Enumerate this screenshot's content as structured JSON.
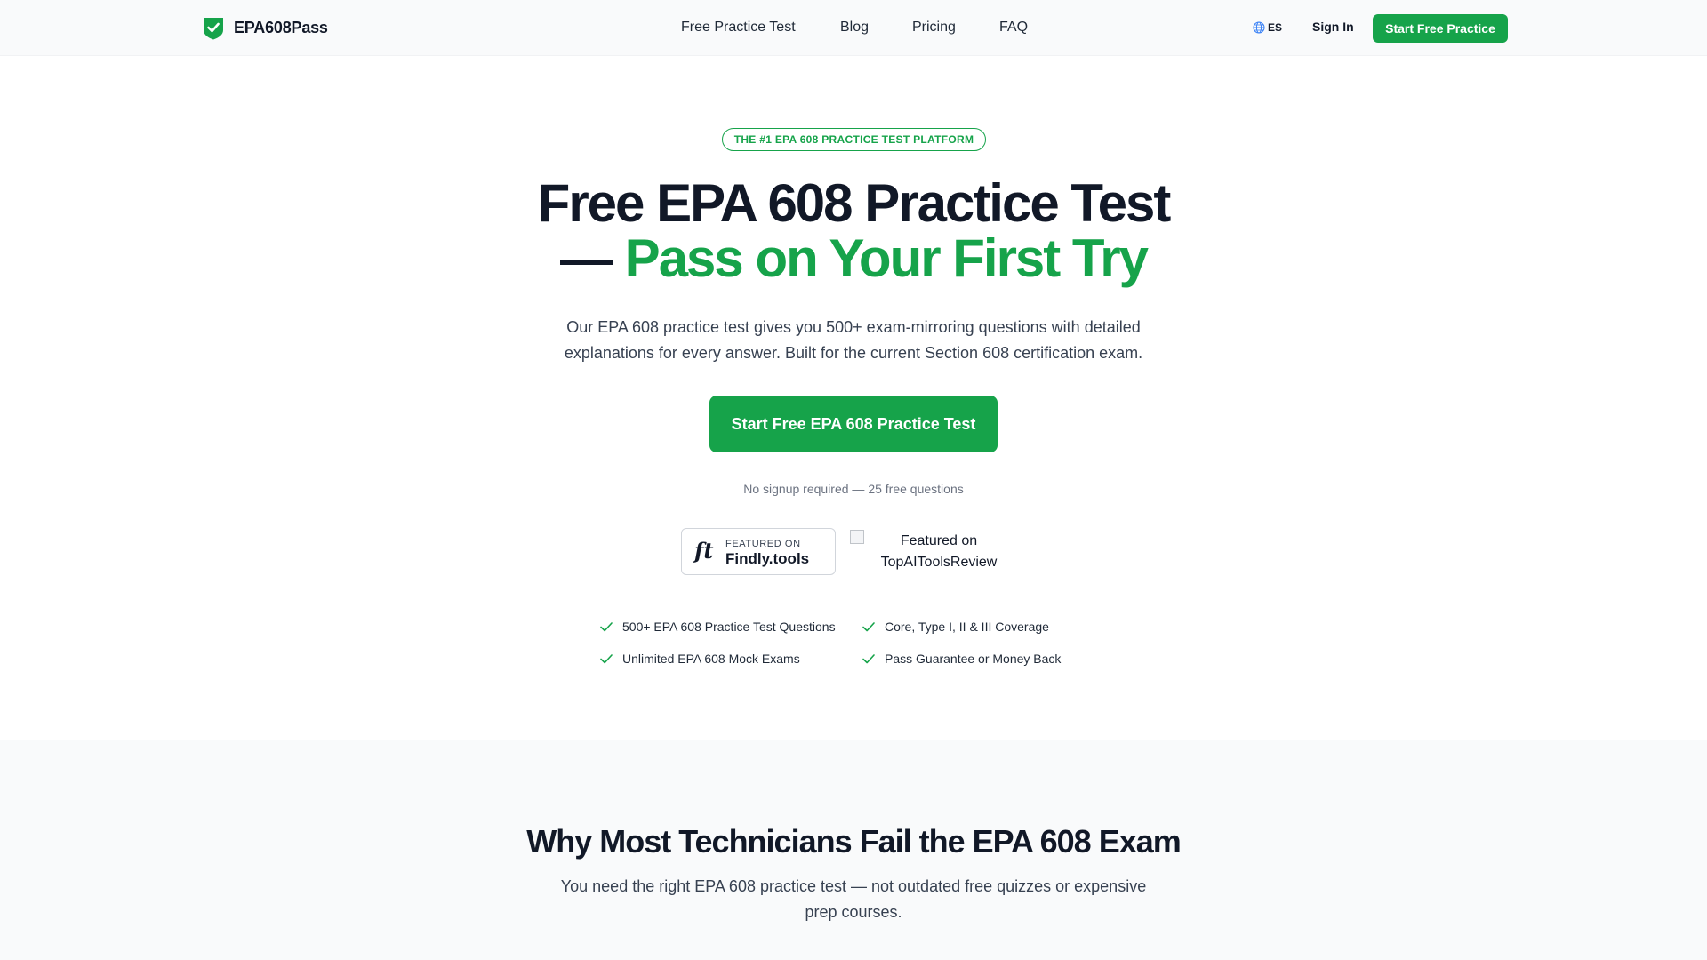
{
  "brand": {
    "name": "EPA608Pass",
    "accent_color": "#16a34a",
    "logo_icon": "shield-check-icon"
  },
  "nav": {
    "items": [
      {
        "label": "Free Practice Test"
      },
      {
        "label": "Blog"
      },
      {
        "label": "Pricing"
      },
      {
        "label": "FAQ"
      }
    ]
  },
  "header": {
    "language": "ES",
    "language_icon": "globe-icon",
    "signin": "Sign In",
    "cta": "Start Free Practice"
  },
  "hero": {
    "badge": "THE #1 EPA 608 PRACTICE TEST PLATFORM",
    "title_line1": "Free EPA 608 Practice Test",
    "title_dash": "—",
    "title_line2": "Pass on Your First Try",
    "subtitle": "Our EPA 608 practice test gives you 500+ exam-mirroring questions with detailed explanations for every answer. Built for the current Section 608 certification exam.",
    "cta": "Start Free EPA 608 Practice Test",
    "note": "No signup required — 25 free questions"
  },
  "featured": {
    "findly_mark": "ft",
    "findly_small": "FEATURED ON",
    "findly_name": "Findly.tools",
    "topai_alt": "Featured on TopAIToolsReview"
  },
  "features": [
    {
      "label": "500+ EPA 608 Practice Test Questions"
    },
    {
      "label": "Core, Type I, II & III Coverage"
    },
    {
      "label": "Unlimited EPA 608 Mock Exams"
    },
    {
      "label": "Pass Guarantee or Money Back"
    }
  ],
  "section2": {
    "title": "Why Most Technicians Fail the EPA 608 Exam",
    "subtitle": "You need the right EPA 608 practice test — not outdated free quizzes or expensive prep courses."
  }
}
